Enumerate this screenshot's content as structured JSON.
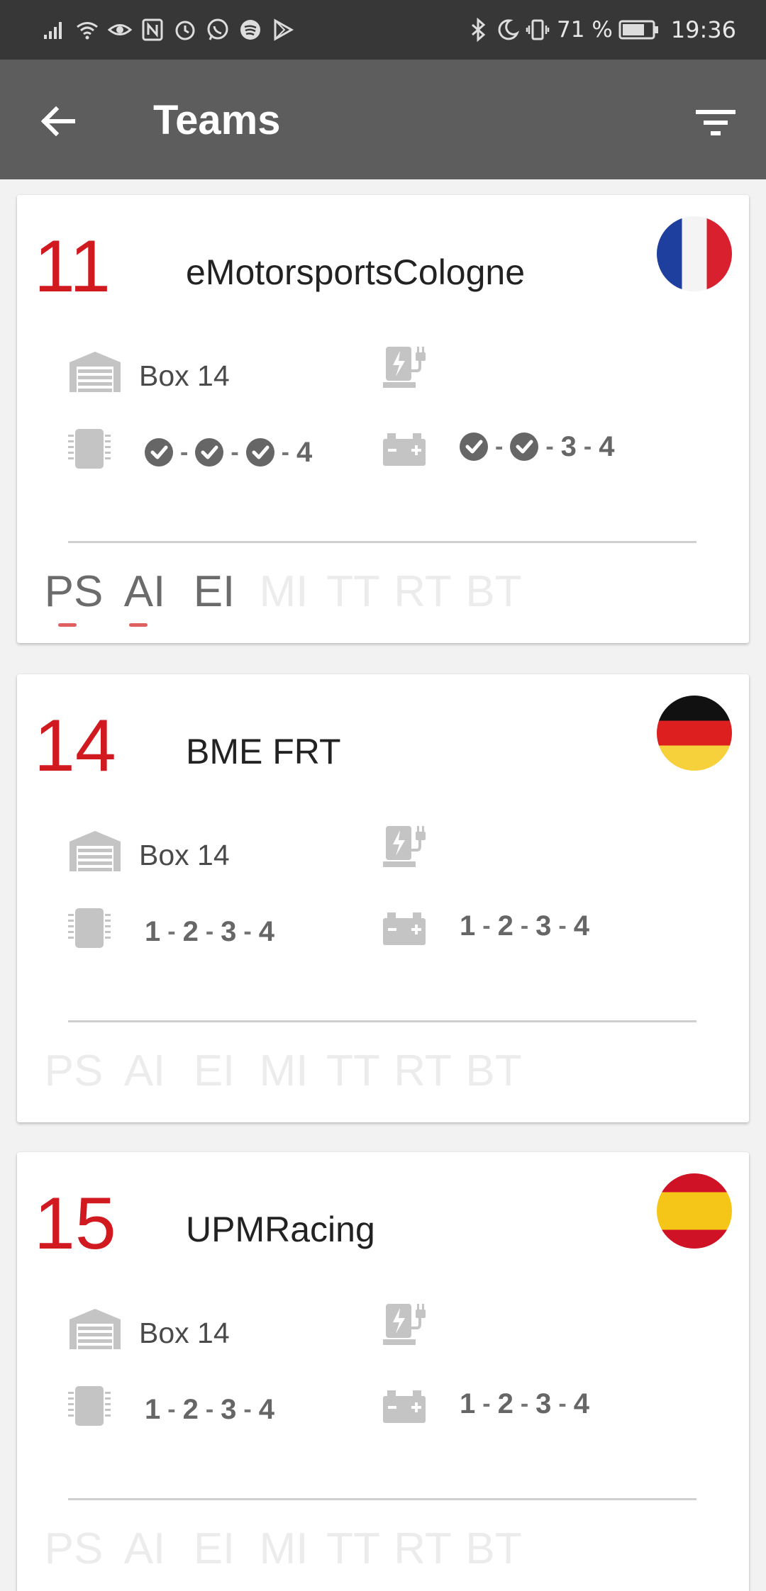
{
  "status_bar": {
    "battery_percent": "71 %",
    "time": "19:36",
    "left_icons": [
      "signal-icon",
      "wifi-icon",
      "eye-icon",
      "nfc-icon",
      "alarm-icon",
      "whatsapp-icon",
      "spotify-icon",
      "play-store-icon"
    ],
    "right_icons": [
      "bluetooth-icon",
      "moon-icon",
      "vibrate-icon",
      "battery-icon"
    ]
  },
  "app_bar": {
    "title": "Teams",
    "back_icon": "arrow-back-icon",
    "filter_icon": "filter-icon",
    "background": "#5d5d5d"
  },
  "colors": {
    "accent_red": "#d11a20",
    "indicator": "#e06060",
    "inactive_tab": "#ececec",
    "active_tab": "#6b6b6b"
  },
  "teams": [
    {
      "number": "11",
      "name": "eMotorsportsCologne",
      "flag": "france",
      "box": "Box 14",
      "chip_steps": [
        "check",
        "check",
        "check",
        "4"
      ],
      "battery_steps": [
        "check",
        "check",
        "3",
        "4"
      ],
      "tabs": [
        {
          "label": "PS",
          "active": true,
          "indicator": true
        },
        {
          "label": "AI",
          "active": true,
          "indicator": true
        },
        {
          "label": "EI",
          "active": true,
          "indicator": false
        },
        {
          "label": "MI",
          "active": false,
          "indicator": false
        },
        {
          "label": "TT",
          "active": false,
          "indicator": false
        },
        {
          "label": "RT",
          "active": false,
          "indicator": false
        },
        {
          "label": "BT",
          "active": false,
          "indicator": false
        }
      ]
    },
    {
      "number": "14",
      "name": "BME FRT",
      "flag": "germany",
      "box": "Box 14",
      "chip_steps": [
        "1",
        "2",
        "3",
        "4"
      ],
      "battery_steps": [
        "1",
        "2",
        "3",
        "4"
      ],
      "tabs": [
        {
          "label": "PS",
          "active": false,
          "indicator": false
        },
        {
          "label": "AI",
          "active": false,
          "indicator": false
        },
        {
          "label": "EI",
          "active": false,
          "indicator": false
        },
        {
          "label": "MI",
          "active": false,
          "indicator": false
        },
        {
          "label": "TT",
          "active": false,
          "indicator": false
        },
        {
          "label": "RT",
          "active": false,
          "indicator": false
        },
        {
          "label": "BT",
          "active": false,
          "indicator": false
        }
      ]
    },
    {
      "number": "15",
      "name": "UPMRacing",
      "flag": "spain",
      "box": "Box 14",
      "chip_steps": [
        "1",
        "2",
        "3",
        "4"
      ],
      "battery_steps": [
        "1",
        "2",
        "3",
        "4"
      ],
      "tabs": [
        {
          "label": "PS",
          "active": false,
          "indicator": false
        },
        {
          "label": "AI",
          "active": false,
          "indicator": false
        },
        {
          "label": "EI",
          "active": false,
          "indicator": false
        },
        {
          "label": "MI",
          "active": false,
          "indicator": false
        },
        {
          "label": "TT",
          "active": false,
          "indicator": false
        },
        {
          "label": "RT",
          "active": false,
          "indicator": false
        },
        {
          "label": "BT",
          "active": false,
          "indicator": false
        }
      ]
    }
  ]
}
